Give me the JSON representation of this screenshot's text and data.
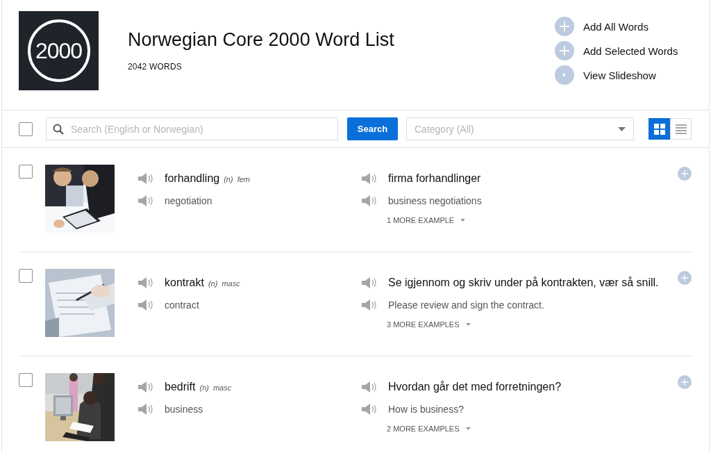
{
  "header": {
    "logo_text": "2000",
    "title": "Norwegian Core 2000 Word List",
    "count": "2042 WORDS",
    "actions": [
      {
        "kind": "add",
        "label": "Add All Words"
      },
      {
        "kind": "add",
        "label": "Add Selected Words"
      },
      {
        "kind": "play",
        "label": "View Slideshow"
      }
    ]
  },
  "toolbar": {
    "select_all": {
      "checked": false
    },
    "search": {
      "placeholder": "Search (English or Norwegian)"
    },
    "search_button": "Search",
    "category": {
      "placeholder": "Category (All)"
    },
    "views": [
      {
        "kind": "grid",
        "selected": true
      },
      {
        "kind": "list",
        "selected": false
      }
    ]
  },
  "words": [
    {
      "checked": false,
      "word": "forhandling",
      "pos": "(n)",
      "gender": "fem",
      "translation": "negotiation",
      "example": "firma forhandlinger",
      "example_translation": "business negotiations",
      "more": "1 MORE EXAMPLE"
    },
    {
      "checked": false,
      "word": "kontrakt",
      "pos": "(n)",
      "gender": "masc",
      "translation": "contract",
      "example": "Se igjennom og skriv under på kontrakten, vær så snill.",
      "example_translation": "Please review and sign the contract.",
      "more": "3 MORE EXAMPLES"
    },
    {
      "checked": false,
      "word": "bedrift",
      "pos": "(n)",
      "gender": "masc",
      "translation": "business",
      "example": "Hvordan går det med forretningen?",
      "example_translation": "How is business?",
      "more": "2 MORE EXAMPLES"
    }
  ]
}
